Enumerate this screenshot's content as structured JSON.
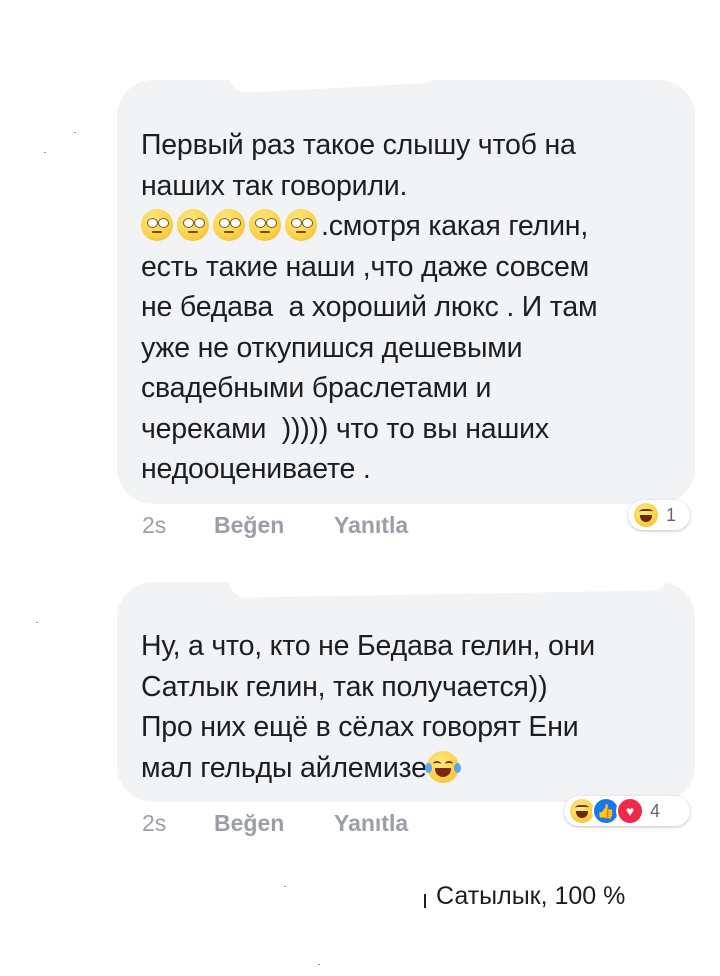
{
  "comments": [
    {
      "text_line1": "Первый раз такое слышу чтоб на\nнаших так говорили.\n",
      "emoji_count_visible": 5,
      "text_after_emoji": ".смотря какая гелин,\nесть такие наши ,что даже совсем\nне бедава  а хороший люкс . И там\nуже не откупишся дешевыми\nсвадебными браслетами и\nчереками  ))))) что то вы наших\nнедооцениваете .",
      "time": "2s",
      "like_label": "Beğen",
      "reply_label": "Yanıtla",
      "reactions": [
        "haha-icon"
      ],
      "reaction_count": "1"
    },
    {
      "text": "Ну, а что, кто не Бедава гелин, они\nСатлык гелин, так получается))\nПро них ещё в сёлах говорят Ени\nмал гельды айлемизе",
      "trailing_emoji": "joy-icon",
      "time": "2s",
      "like_label": "Beğen",
      "reply_label": "Yanıtla",
      "reactions": [
        "haha-icon",
        "like-icon",
        "love-icon"
      ],
      "reaction_count": "4"
    }
  ],
  "caption": "Сатылык, 100 %",
  "colors": {
    "bubble": "#f2f3f5",
    "text": "#1c1e21",
    "meta": "#9a9ea6",
    "like_blue": "#1877f2",
    "love_red": "#f02849"
  }
}
